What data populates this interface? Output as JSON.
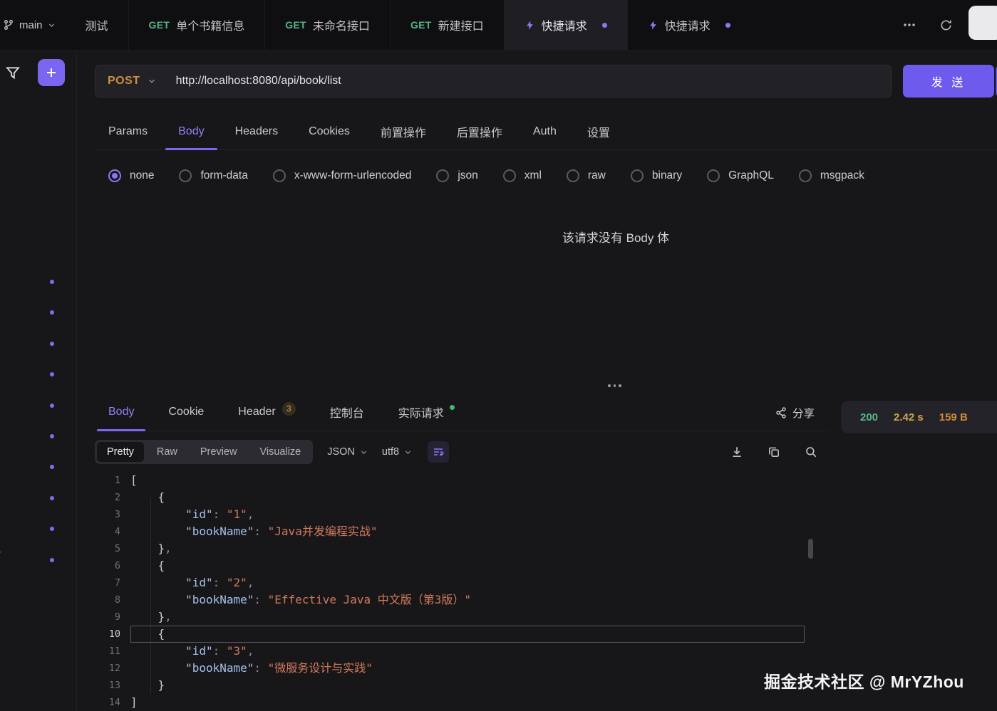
{
  "header": {
    "branch_label": "main",
    "tabs": [
      {
        "label": "测试"
      },
      {
        "method": "GET",
        "label": "单个书籍信息"
      },
      {
        "method": "GET",
        "label": "未命名接口"
      },
      {
        "method": "GET",
        "label": "新建接口"
      },
      {
        "quick": true,
        "label": "快捷请求",
        "active": true,
        "modified": true
      },
      {
        "quick": true,
        "label": "快捷请求",
        "modified": true
      }
    ]
  },
  "sidebar": {
    "indicator_dot_count": 10,
    "partial_path_text": "/"
  },
  "request": {
    "method": "POST",
    "url": "http://localhost:8080/api/book/list",
    "send_label": "发 送",
    "tabs": [
      {
        "label": "Params"
      },
      {
        "label": "Body",
        "active": true
      },
      {
        "label": "Headers"
      },
      {
        "label": "Cookies"
      },
      {
        "label": "前置操作"
      },
      {
        "label": "后置操作"
      },
      {
        "label": "Auth"
      },
      {
        "label": "设置"
      }
    ],
    "body_types": [
      {
        "label": "none",
        "selected": true
      },
      {
        "label": "form-data"
      },
      {
        "label": "x-www-form-urlencoded"
      },
      {
        "label": "json"
      },
      {
        "label": "xml"
      },
      {
        "label": "raw"
      },
      {
        "label": "binary"
      },
      {
        "label": "GraphQL"
      },
      {
        "label": "msgpack"
      }
    ],
    "empty_body_message": "该请求没有 Body 体"
  },
  "response": {
    "tabs": [
      {
        "label": "Body",
        "active": true
      },
      {
        "label": "Cookie"
      },
      {
        "label": "Header",
        "badge": "3"
      },
      {
        "label": "控制台"
      },
      {
        "label": "实际请求",
        "dot": true
      }
    ],
    "share_label": "分享",
    "status": {
      "code": "200",
      "time": "2.42 s",
      "size": "159 B"
    },
    "toolbar": {
      "modes": [
        {
          "label": "Pretty",
          "active": true
        },
        {
          "label": "Raw"
        },
        {
          "label": "Preview"
        },
        {
          "label": "Visualize"
        }
      ],
      "format_select": "JSON",
      "encoding_select": "utf8"
    },
    "code": {
      "language": "json",
      "lines": [
        {
          "n": "1",
          "tokens": [
            [
              "br",
              "["
            ]
          ]
        },
        {
          "n": "2",
          "tokens": [
            [
              "ws",
              "    "
            ],
            [
              "br",
              "{"
            ]
          ]
        },
        {
          "n": "3",
          "tokens": [
            [
              "ws",
              "        "
            ],
            [
              "key",
              "\"id\""
            ],
            [
              "pun",
              ": "
            ],
            [
              "str",
              "\"1\""
            ],
            [
              "pun",
              ","
            ]
          ]
        },
        {
          "n": "4",
          "tokens": [
            [
              "ws",
              "        "
            ],
            [
              "key",
              "\"bookName\""
            ],
            [
              "pun",
              ": "
            ],
            [
              "str",
              "\"Java并发编程实战\""
            ]
          ]
        },
        {
          "n": "5",
          "tokens": [
            [
              "ws",
              "    "
            ],
            [
              "br",
              "}"
            ],
            [
              "pun",
              ","
            ]
          ]
        },
        {
          "n": "6",
          "tokens": [
            [
              "ws",
              "    "
            ],
            [
              "br",
              "{"
            ]
          ]
        },
        {
          "n": "7",
          "tokens": [
            [
              "ws",
              "        "
            ],
            [
              "key",
              "\"id\""
            ],
            [
              "pun",
              ": "
            ],
            [
              "str",
              "\"2\""
            ],
            [
              "pun",
              ","
            ]
          ]
        },
        {
          "n": "8",
          "tokens": [
            [
              "ws",
              "        "
            ],
            [
              "key",
              "\"bookName\""
            ],
            [
              "pun",
              ": "
            ],
            [
              "str",
              "\"Effective Java 中文版（第3版）\""
            ]
          ]
        },
        {
          "n": "9",
          "tokens": [
            [
              "ws",
              "    "
            ],
            [
              "br",
              "}"
            ],
            [
              "pun",
              ","
            ]
          ]
        },
        {
          "n": "10",
          "active": true,
          "tokens": [
            [
              "ws",
              "    "
            ],
            [
              "br",
              "{"
            ]
          ]
        },
        {
          "n": "11",
          "tokens": [
            [
              "ws",
              "        "
            ],
            [
              "key",
              "\"id\""
            ],
            [
              "pun",
              ": "
            ],
            [
              "str",
              "\"3\""
            ],
            [
              "pun",
              ","
            ]
          ]
        },
        {
          "n": "12",
          "tokens": [
            [
              "ws",
              "        "
            ],
            [
              "key",
              "\"bookName\""
            ],
            [
              "pun",
              ": "
            ],
            [
              "str",
              "\"微服务设计与实践\""
            ]
          ]
        },
        {
          "n": "13",
          "tokens": [
            [
              "ws",
              "    "
            ],
            [
              "br",
              "}"
            ]
          ]
        },
        {
          "n": "14",
          "tokens": [
            [
              "br",
              "]"
            ]
          ]
        }
      ]
    }
  },
  "watermark": "掘金技术社区 @ MrYZhou",
  "colors": {
    "accent": "#7b68f0",
    "method_post": "#cf8f3e",
    "method_get": "#52b586",
    "status_ok": "#58b884",
    "status_time": "#d2a546",
    "status_size": "#d0893c",
    "code_key": "#a6c1ea",
    "code_string": "#d2795b"
  }
}
